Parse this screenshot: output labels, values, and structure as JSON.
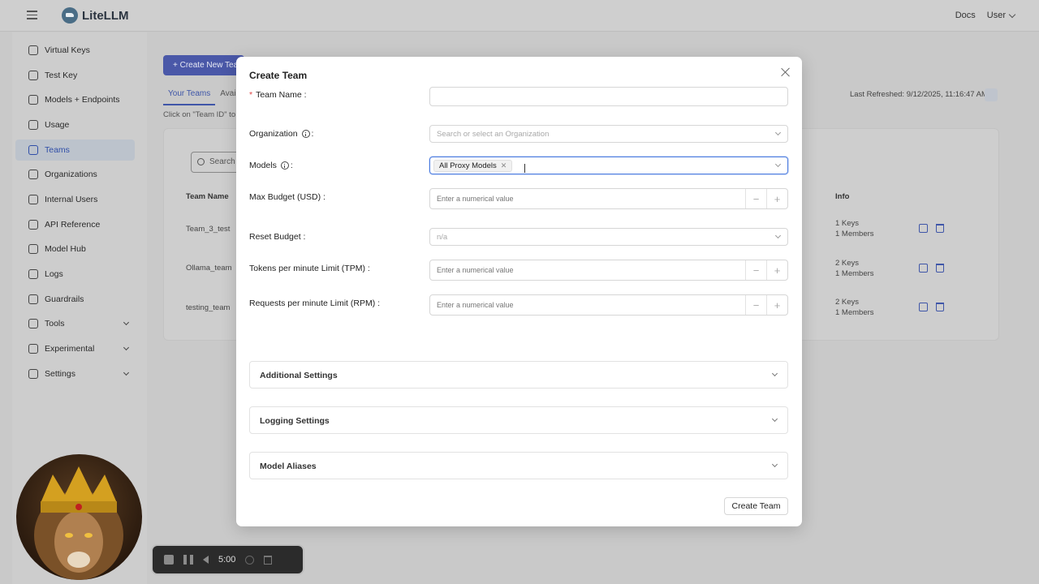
{
  "app": {
    "name": "LiteLLM"
  },
  "topbar": {
    "docs": "Docs",
    "user": "User"
  },
  "sidebar": {
    "items": [
      {
        "label": "Virtual Keys"
      },
      {
        "label": "Test Key"
      },
      {
        "label": "Models + Endpoints"
      },
      {
        "label": "Usage"
      },
      {
        "label": "Teams"
      },
      {
        "label": "Organizations"
      },
      {
        "label": "Internal Users"
      },
      {
        "label": "API Reference"
      },
      {
        "label": "Model Hub"
      },
      {
        "label": "Logs"
      },
      {
        "label": "Guardrails"
      },
      {
        "label": "Tools"
      },
      {
        "label": "Experimental"
      },
      {
        "label": "Settings"
      }
    ],
    "active": "Teams"
  },
  "main": {
    "create_button": "+ Create New Team",
    "tabs": [
      "Your Teams",
      "Availa"
    ],
    "hint": "Click on \"Team ID\" to",
    "last_refreshed": "Last Refreshed: 9/12/2025, 11:16:47 AM",
    "search_placeholder": "Search",
    "columns": {
      "name": "Team Name",
      "info": "Info"
    },
    "rows": [
      {
        "name": "Team_3_test",
        "keys": "1 Keys",
        "members": "1 Members"
      },
      {
        "name": "Ollama_team",
        "keys": "2 Keys",
        "members": "1 Members"
      },
      {
        "name": "testing_team",
        "keys": "2 Keys",
        "members": "1 Members"
      }
    ]
  },
  "modal": {
    "title": "Create Team",
    "fields": {
      "team_name": {
        "label": "Team Name",
        "value": ""
      },
      "organization": {
        "label": "Organization",
        "placeholder": "Search or select an Organization"
      },
      "models": {
        "label": "Models",
        "tag": "All Proxy Models"
      },
      "max_budget": {
        "label": "Max Budget (USD)",
        "placeholder": "Enter a numerical value"
      },
      "reset_budget": {
        "label": "Reset Budget",
        "placeholder": "n/a"
      },
      "tpm": {
        "label": "Tokens per minute Limit (TPM)",
        "placeholder": "Enter a numerical value"
      },
      "rpm": {
        "label": "Requests per minute Limit (RPM)",
        "placeholder": "Enter a numerical value"
      }
    },
    "sections": [
      "Additional Settings",
      "Logging Settings",
      "Model Aliases"
    ],
    "submit": "Create Team"
  },
  "recorder": {
    "time": "5:00"
  },
  "colors": {
    "accent": "#4d7de0",
    "primary": "#4a58a8",
    "required": "#e04545"
  }
}
